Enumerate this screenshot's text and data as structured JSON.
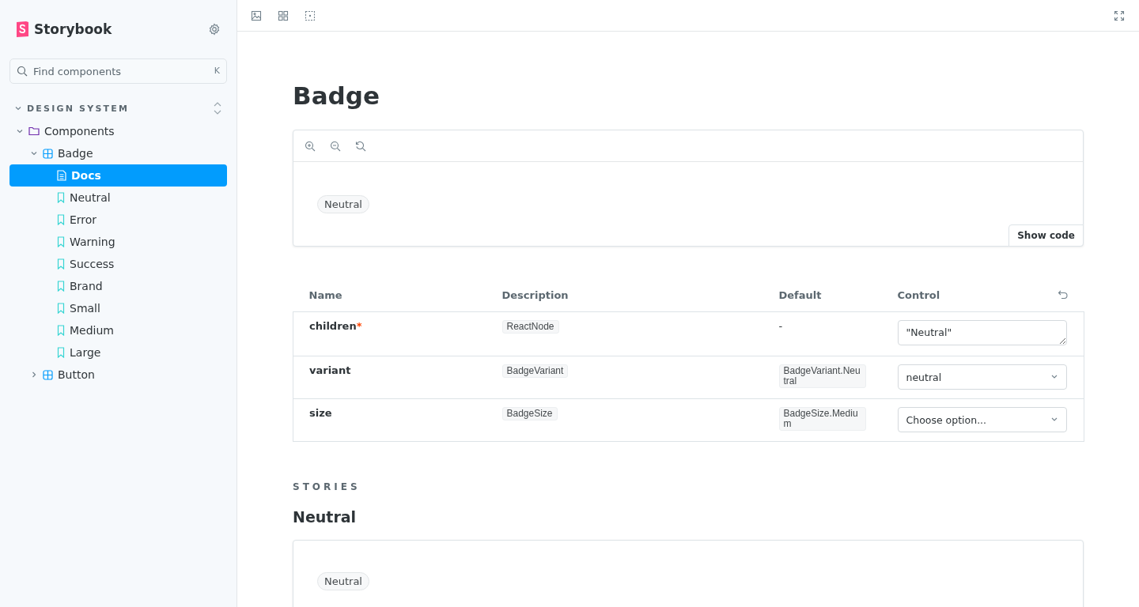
{
  "sidebar": {
    "brand": "Storybook",
    "search": {
      "placeholder": "Find components",
      "shortcut": "K"
    },
    "section": {
      "label": "DESIGN SYSTEM",
      "expanded": true,
      "items": [
        {
          "label": "Components",
          "kind": "folder",
          "expanded": true,
          "selected": false,
          "children": [
            {
              "label": "Badge",
              "kind": "component",
              "expanded": true,
              "selected": false,
              "children": [
                {
                  "label": "Docs",
                  "kind": "docs",
                  "selected": true
                },
                {
                  "label": "Neutral",
                  "kind": "story",
                  "selected": false
                },
                {
                  "label": "Error",
                  "kind": "story",
                  "selected": false
                },
                {
                  "label": "Warning",
                  "kind": "story",
                  "selected": false
                },
                {
                  "label": "Success",
                  "kind": "story",
                  "selected": false
                },
                {
                  "label": "Brand",
                  "kind": "story",
                  "selected": false
                },
                {
                  "label": "Small",
                  "kind": "story",
                  "selected": false
                },
                {
                  "label": "Medium",
                  "kind": "story",
                  "selected": false
                },
                {
                  "label": "Large",
                  "kind": "story",
                  "selected": false
                }
              ]
            },
            {
              "label": "Button",
              "kind": "component",
              "expanded": false,
              "selected": false
            }
          ]
        }
      ]
    }
  },
  "docs": {
    "title": "Badge",
    "preview": {
      "badge": "Neutral",
      "show_code": "Show code"
    },
    "args_table": {
      "columns": [
        "Name",
        "Description",
        "Default",
        "Control"
      ],
      "rows": [
        {
          "name": "children",
          "required_mark": "*",
          "description": "ReactNode",
          "default": {
            "text": "-",
            "kind": "plain"
          },
          "control": {
            "kind": "textarea",
            "value": "\"Neutral\""
          }
        },
        {
          "name": "variant",
          "description": "BadgeVariant",
          "default": {
            "text": "BadgeVariant.Neutral",
            "kind": "code"
          },
          "control": {
            "kind": "select",
            "value": "neutral"
          }
        },
        {
          "name": "size",
          "description": "BadgeSize",
          "default": {
            "text": "BadgeSize.Medium",
            "kind": "code"
          },
          "control": {
            "kind": "select",
            "placeholder": "Choose option..."
          }
        }
      ]
    },
    "stories_heading": "STORIES",
    "stories": [
      {
        "title": "Neutral",
        "badge": "Neutral"
      }
    ]
  }
}
